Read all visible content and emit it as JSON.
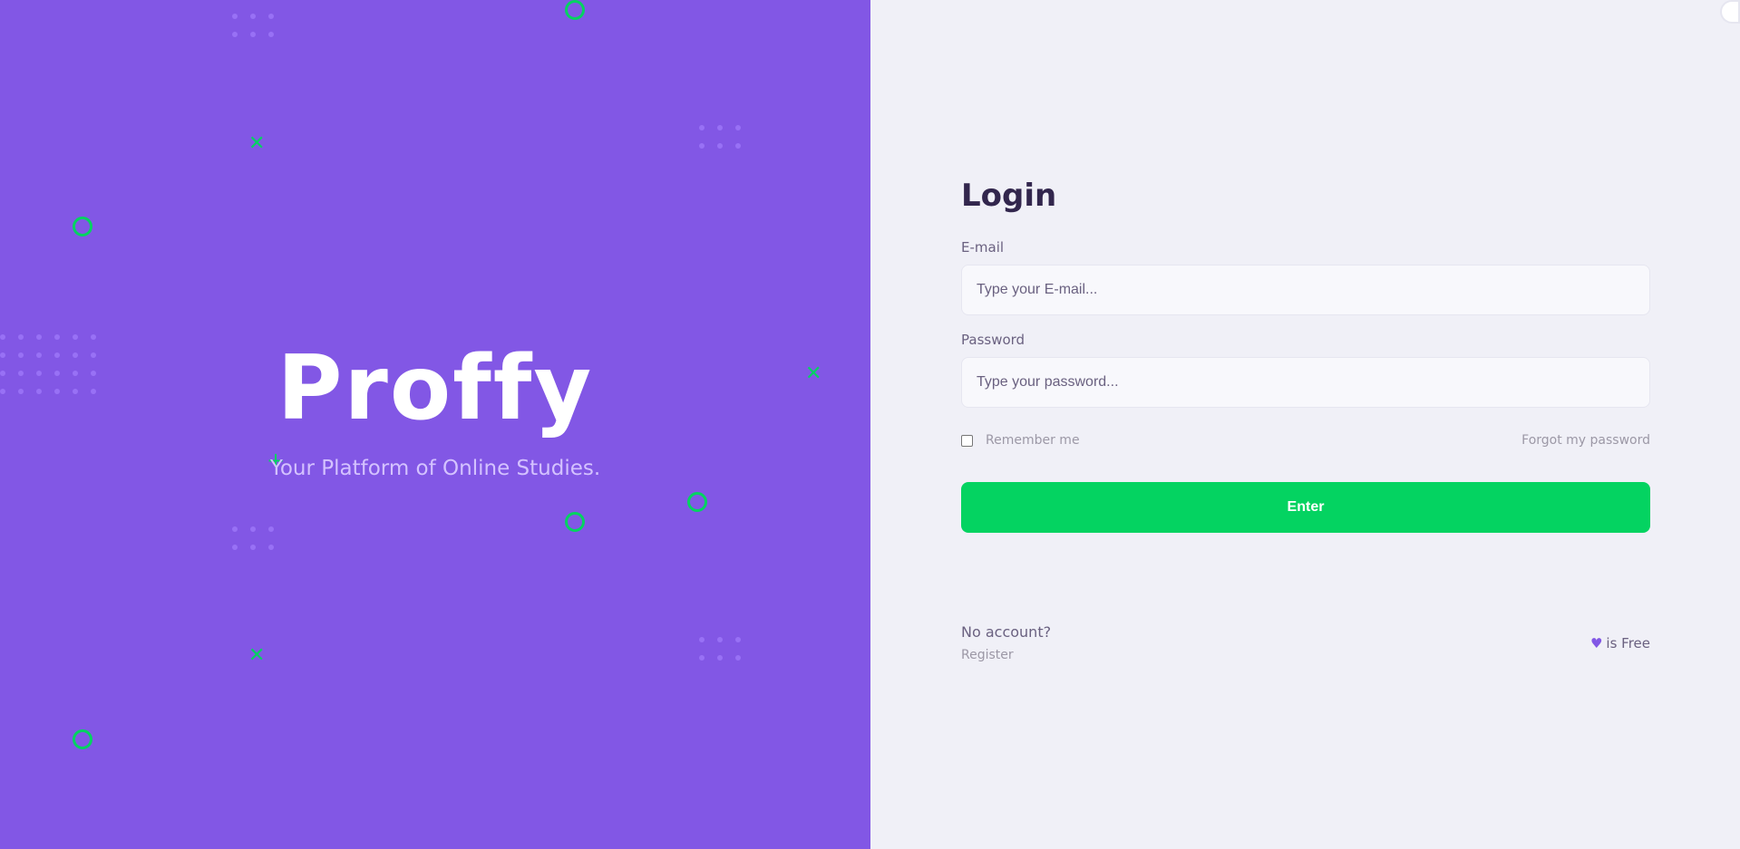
{
  "brand": {
    "logo_text": "Proffy",
    "tagline": "Your Platform of Online Studies."
  },
  "login": {
    "title": "Login",
    "email_label": "E-mail",
    "email_placeholder": "Type your E-mail...",
    "email_value": "",
    "password_label": "Password",
    "password_placeholder": "Type your password...",
    "password_value": "",
    "remember_label": "Remember me",
    "remember_checked": false,
    "forgot_label": "Forgot my password",
    "enter_label": "Enter"
  },
  "footer": {
    "no_account": "No account?",
    "register": "Register",
    "free_text": "is Free",
    "heart_icon": "heart-icon"
  },
  "icons": {
    "theme_toggle": "theme-toggle-icon"
  },
  "colors": {
    "primary": "#8257e5",
    "secondary": "#04d361",
    "background": "#f0f0f7",
    "title": "#32264d",
    "text": "#6a6180"
  }
}
